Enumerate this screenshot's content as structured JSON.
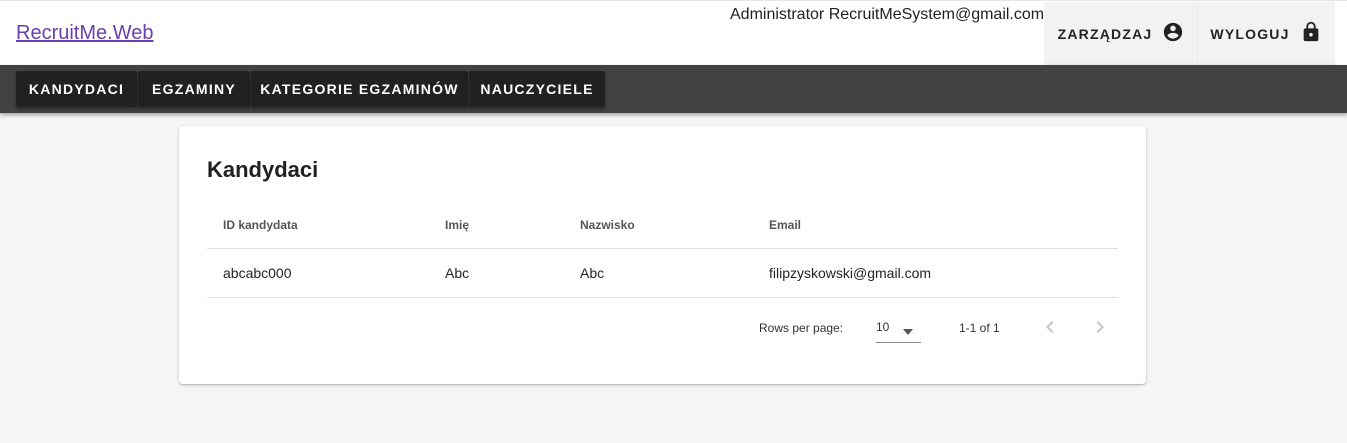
{
  "header": {
    "brand": "RecruitMe.Web",
    "user_info": "Administrator RecruitMeSystem@gmail.com",
    "manage_label": "ZARZĄDZAJ",
    "manage_icon": "account-circle-icon",
    "logout_label": "WYLOGUJ",
    "logout_icon": "lock-icon"
  },
  "nav": {
    "items": [
      {
        "label": "KANDYDACI"
      },
      {
        "label": "EGZAMINY"
      },
      {
        "label": "KATEGORIE EGZAMINÓW"
      },
      {
        "label": "NAUCZYCIELE"
      }
    ]
  },
  "main": {
    "title": "Kandydaci",
    "table": {
      "columns": [
        "ID kandydata",
        "Imię",
        "Nazwisko",
        "Email"
      ],
      "rows": [
        [
          "abcabc000",
          "Abc",
          "Abc",
          "filipzyskowski@gmail.com"
        ]
      ]
    },
    "pagination": {
      "rows_per_page_label": "Rows per page:",
      "rows_per_page_value": "10",
      "range_text": "1-1 of 1"
    }
  },
  "colors": {
    "brand_link": "#6a3fb0",
    "navbar_bg": "#424242",
    "nav_button_bg": "#212121",
    "page_bg": "#f5f5f5"
  }
}
